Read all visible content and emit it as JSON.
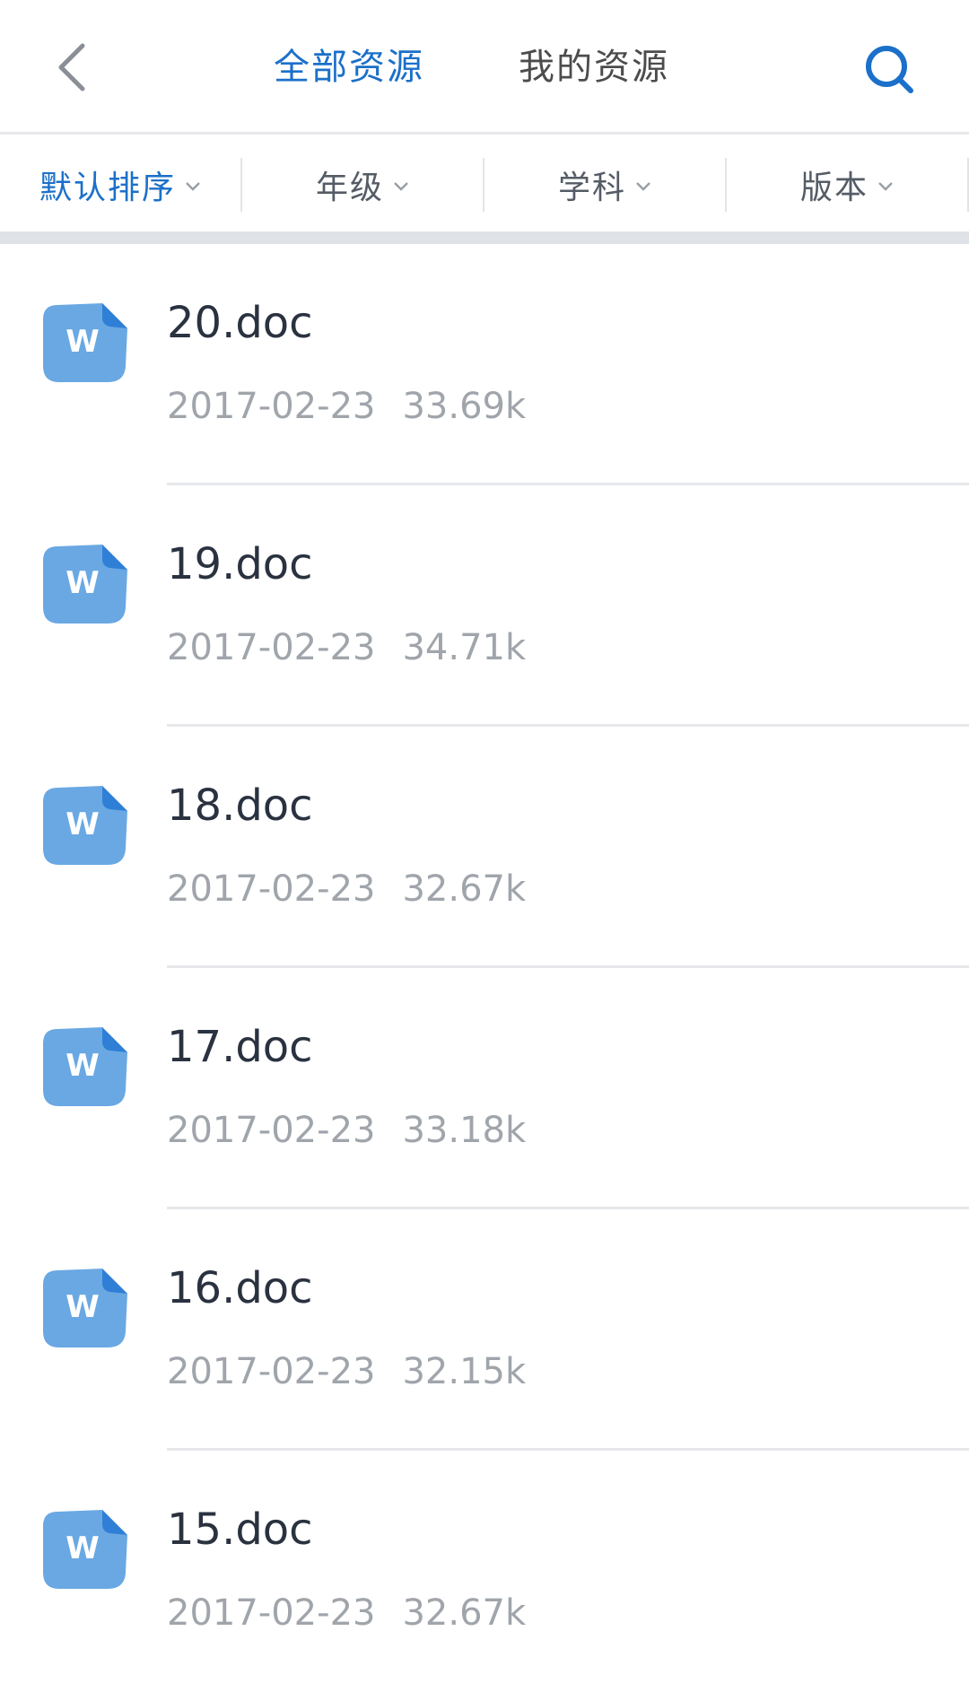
{
  "header": {
    "back_icon": "chevron-left-icon",
    "tabs": [
      {
        "label": "全部资源",
        "active": true
      },
      {
        "label": "我的资源",
        "active": false
      }
    ],
    "search_icon": "search-icon"
  },
  "filters": [
    {
      "label": "默认排序",
      "active": true
    },
    {
      "label": "年级",
      "active": false
    },
    {
      "label": "学科",
      "active": false
    },
    {
      "label": "版本",
      "active": false
    }
  ],
  "files": [
    {
      "name": "20.doc",
      "date": "2017-02-23",
      "size": "33.69k",
      "icon_letter": "W"
    },
    {
      "name": "19.doc",
      "date": "2017-02-23",
      "size": "34.71k",
      "icon_letter": "W"
    },
    {
      "name": "18.doc",
      "date": "2017-02-23",
      "size": "32.67k",
      "icon_letter": "W"
    },
    {
      "name": "17.doc",
      "date": "2017-02-23",
      "size": "33.18k",
      "icon_letter": "W"
    },
    {
      "name": "16.doc",
      "date": "2017-02-23",
      "size": "32.15k",
      "icon_letter": "W"
    },
    {
      "name": "15.doc",
      "date": "2017-02-23",
      "size": "32.67k",
      "icon_letter": "W"
    }
  ],
  "colors": {
    "accent": "#1b70c9",
    "icon_fill": "#6aa8e3",
    "icon_fold": "#2f7fd6",
    "meta_text": "#a0a5ab"
  }
}
